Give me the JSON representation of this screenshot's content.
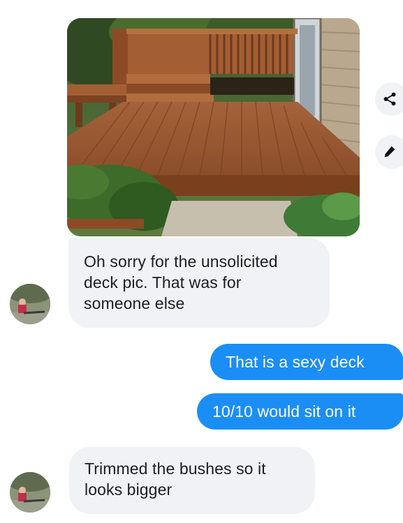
{
  "conversation": {
    "photo": {
      "subject": "wooden deck photo"
    },
    "actions": {
      "share_icon": "share-icon",
      "edit_icon": "pencil-icon"
    },
    "messages": [
      {
        "sender": "them",
        "lines": [
          "Oh sorry for the unsolicited",
          "deck pic. That was for",
          "someone else"
        ]
      },
      {
        "sender": "me",
        "text": "That is a sexy deck"
      },
      {
        "sender": "me",
        "text": "10/10 would sit on it"
      },
      {
        "sender": "them",
        "lines": [
          "Trimmed the bushes so it",
          "looks bigger"
        ]
      }
    ]
  },
  "colors": {
    "outgoing_bubble": "#1b8ef6",
    "incoming_bubble": "#f0f2f5",
    "incoming_text": "#1c1e21",
    "outgoing_text": "#ffffff"
  }
}
